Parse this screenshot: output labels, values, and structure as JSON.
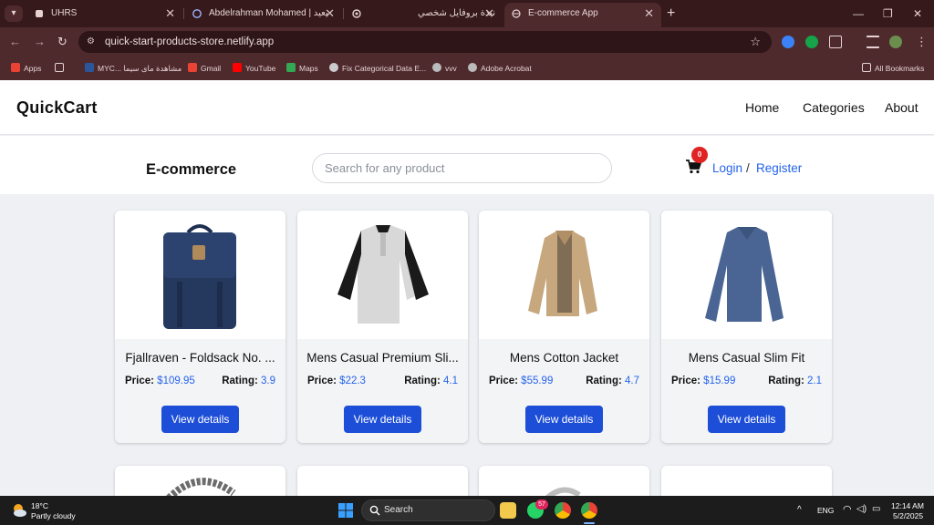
{
  "browser": {
    "tabs": [
      {
        "title": "UHRS",
        "active": false
      },
      {
        "title": "Abdelrahman Mohamed | يعيد",
        "active": false
      },
      {
        "title": "نبذة بروفايل شخصي",
        "active": false
      },
      {
        "title": "E-commerce App",
        "active": true
      }
    ],
    "url": "quick-start-products-store.netlify.app",
    "bookmarks": [
      {
        "label": "Apps",
        "icon": "apps-grid-icon"
      },
      {
        "label": "",
        "icon": "grid-icon"
      },
      {
        "label": "MYC... مشاهدة ماى سيما",
        "icon": "w-icon"
      },
      {
        "label": "Gmail",
        "icon": "gmail-icon"
      },
      {
        "label": "YouTube",
        "icon": "youtube-icon"
      },
      {
        "label": "Maps",
        "icon": "maps-icon"
      },
      {
        "label": "Fix Categorical Data E...",
        "icon": "link-icon"
      },
      {
        "label": "vvv",
        "icon": "globe-icon"
      },
      {
        "label": "Adobe Acrobat",
        "icon": "globe-icon"
      }
    ],
    "all_bookmarks": "All Bookmarks"
  },
  "site": {
    "brand": "QuickCart",
    "nav": [
      "Home",
      "Categories",
      "About"
    ],
    "subtitle": "E-commerce",
    "search_placeholder": "Search for any product",
    "cart_count": "0",
    "login": "Login",
    "separator": "/",
    "register": "Register"
  },
  "products": [
    {
      "title": "Fjallraven - Foldsack No. ...",
      "price_label": "Price:",
      "price": "$109.95",
      "rating_label": "Rating:",
      "rating": "3.9",
      "button": "View details",
      "image": "backpack-image"
    },
    {
      "title": "Mens Casual Premium Sli...",
      "price_label": "Price:",
      "price": "$22.3",
      "rating_label": "Rating:",
      "rating": "4.1",
      "button": "View details",
      "image": "tshirt-image"
    },
    {
      "title": "Mens Cotton Jacket",
      "price_label": "Price:",
      "price": "$55.99",
      "rating_label": "Rating:",
      "rating": "4.7",
      "button": "View details",
      "image": "jacket-image"
    },
    {
      "title": "Mens Casual Slim Fit",
      "price_label": "Price:",
      "price": "$15.99",
      "rating_label": "Rating:",
      "rating": "2.1",
      "button": "View details",
      "image": "sweater-image"
    }
  ],
  "taskbar": {
    "temperature": "18°C",
    "weather": "Partly cloudy",
    "search": "Search",
    "whatsapp_badge": "57",
    "lang": "ENG",
    "time": "12:14 AM",
    "date": "5/2/2025"
  },
  "colors": {
    "accent": "#1d4ed8",
    "link": "#2563eb",
    "badge": "#e02424",
    "chrome_frame": "#3b1d1f"
  }
}
